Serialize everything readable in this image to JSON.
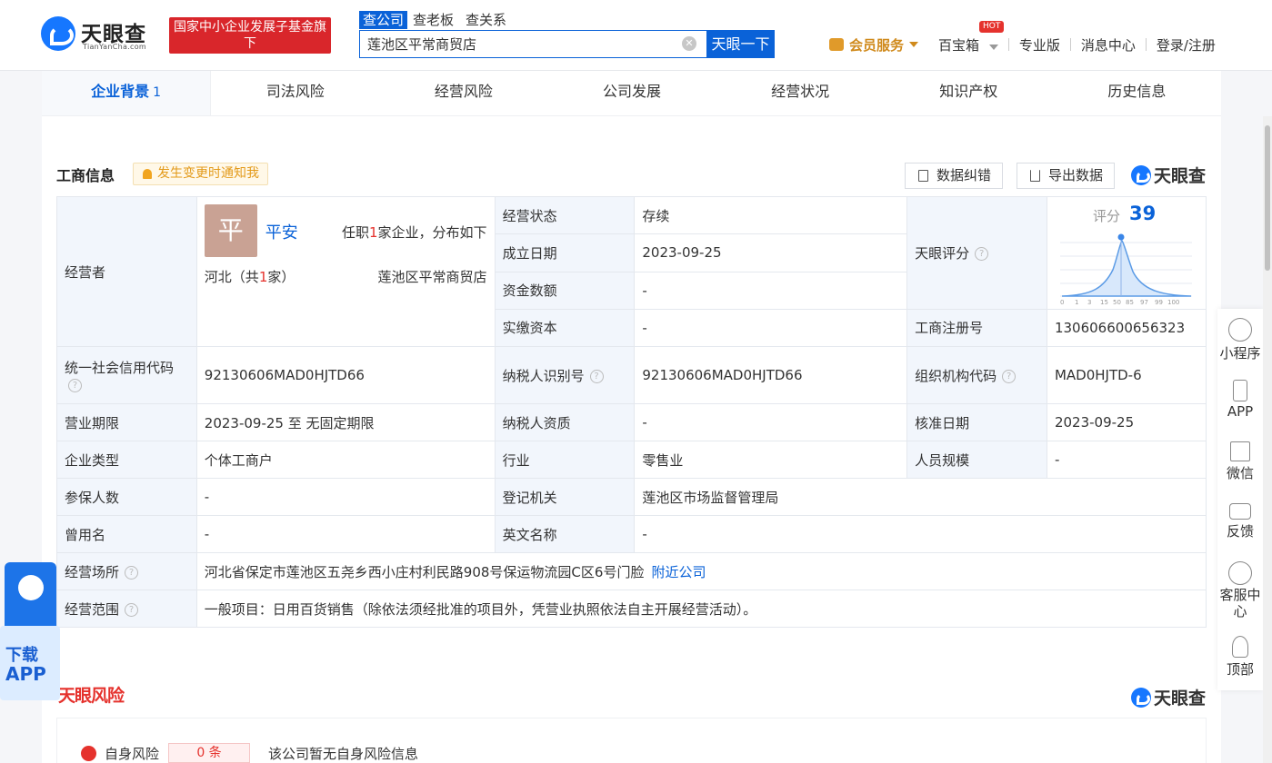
{
  "header": {
    "logo_name": "天眼查",
    "logo_sub": "TianYanCha.com",
    "banner_text": "国家中小企业发展子基金旗下",
    "search_tabs": [
      "查公司",
      "查老板",
      "查关系"
    ],
    "search_value": "莲池区平常商贸店",
    "search_button": "天眼一下",
    "nav": {
      "vip": "会员服务",
      "baobox": "百宝箱",
      "hot": "HOT",
      "pro": "专业版",
      "messages": "消息中心",
      "login": "登录/注册"
    }
  },
  "tabs": [
    {
      "label": "企业背景",
      "count": "1"
    },
    {
      "label": "司法风险"
    },
    {
      "label": "经营风险"
    },
    {
      "label": "公司发展"
    },
    {
      "label": "经营状况"
    },
    {
      "label": "知识产权"
    },
    {
      "label": "历史信息"
    }
  ],
  "section": {
    "title": "工商信息",
    "notify": "发生变更时通知我",
    "correct_btn": "数据纠错",
    "export_btn": "导出数据",
    "brand": "天眼查"
  },
  "info": {
    "operator_label": "经营者",
    "avatar_char": "平",
    "operator_name": "平安",
    "operator_desc_pre": "任职",
    "operator_desc_num": "1",
    "operator_desc_post": "家企业，分布如下",
    "region_pre": "河北（共",
    "region_num": "1",
    "region_post": "家）",
    "region_company": "莲池区平常商贸店",
    "status_label": "经营状态",
    "status_value": "存续",
    "found_label": "成立日期",
    "found_value": "2023-09-25",
    "capital_label": "资金数额",
    "capital_value": "-",
    "paid_label": "实缴资本",
    "paid_value": "-",
    "score_label_cell": "天眼评分",
    "score_label": "评分",
    "score_value": "39",
    "reg_no_label": "工商注册号",
    "reg_no_value": "130606600656323",
    "credit_label": "统一社会信用代码",
    "credit_value": "92130606MAD0HJTD66",
    "taxid_label": "纳税人识别号",
    "taxid_value": "92130606MAD0HJTD66",
    "org_label": "组织机构代码",
    "org_value": "MAD0HJTD-6",
    "term_label": "营业期限",
    "term_value": "2023-09-25 至 无固定期限",
    "taxq_label": "纳税人资质",
    "taxq_value": "-",
    "approve_label": "核准日期",
    "approve_value": "2023-09-25",
    "type_label": "企业类型",
    "type_value": "个体工商户",
    "industry_label": "行业",
    "industry_value": "零售业",
    "staff_label": "人员规模",
    "staff_value": "-",
    "insured_label": "参保人数",
    "insured_value": "-",
    "authority_label": "登记机关",
    "authority_value": "莲池区市场监督管理局",
    "former_label": "曾用名",
    "former_value": "-",
    "en_label": "英文名称",
    "en_value": "-",
    "address_label": "经营场所",
    "address_value": "河北省保定市莲池区五尧乡西小庄村利民路908号保运物流园C区6号门脸",
    "nearby": "附近公司",
    "scope_label": "经营范围",
    "scope_value": "一般项目：日用百货销售（除依法须经批准的项目外，凭营业执照依法自主开展经营活动）。"
  },
  "risk": {
    "title": "天眼风险",
    "brand": "天眼查",
    "self_label": "自身风险",
    "self_count": "0 条",
    "self_desc": "该公司暂无自身风险信息"
  },
  "sidebar": {
    "mini": "小程序",
    "app": "APP",
    "wechat": "微信",
    "feedback": "反馈",
    "service": "客服中心",
    "top": "顶部"
  },
  "app_download": {
    "line1": "下载",
    "line2": "APP"
  },
  "colors": {
    "primary": "#0a62d8",
    "danger": "#e5322d",
    "label_bg": "#f2f6fc"
  }
}
